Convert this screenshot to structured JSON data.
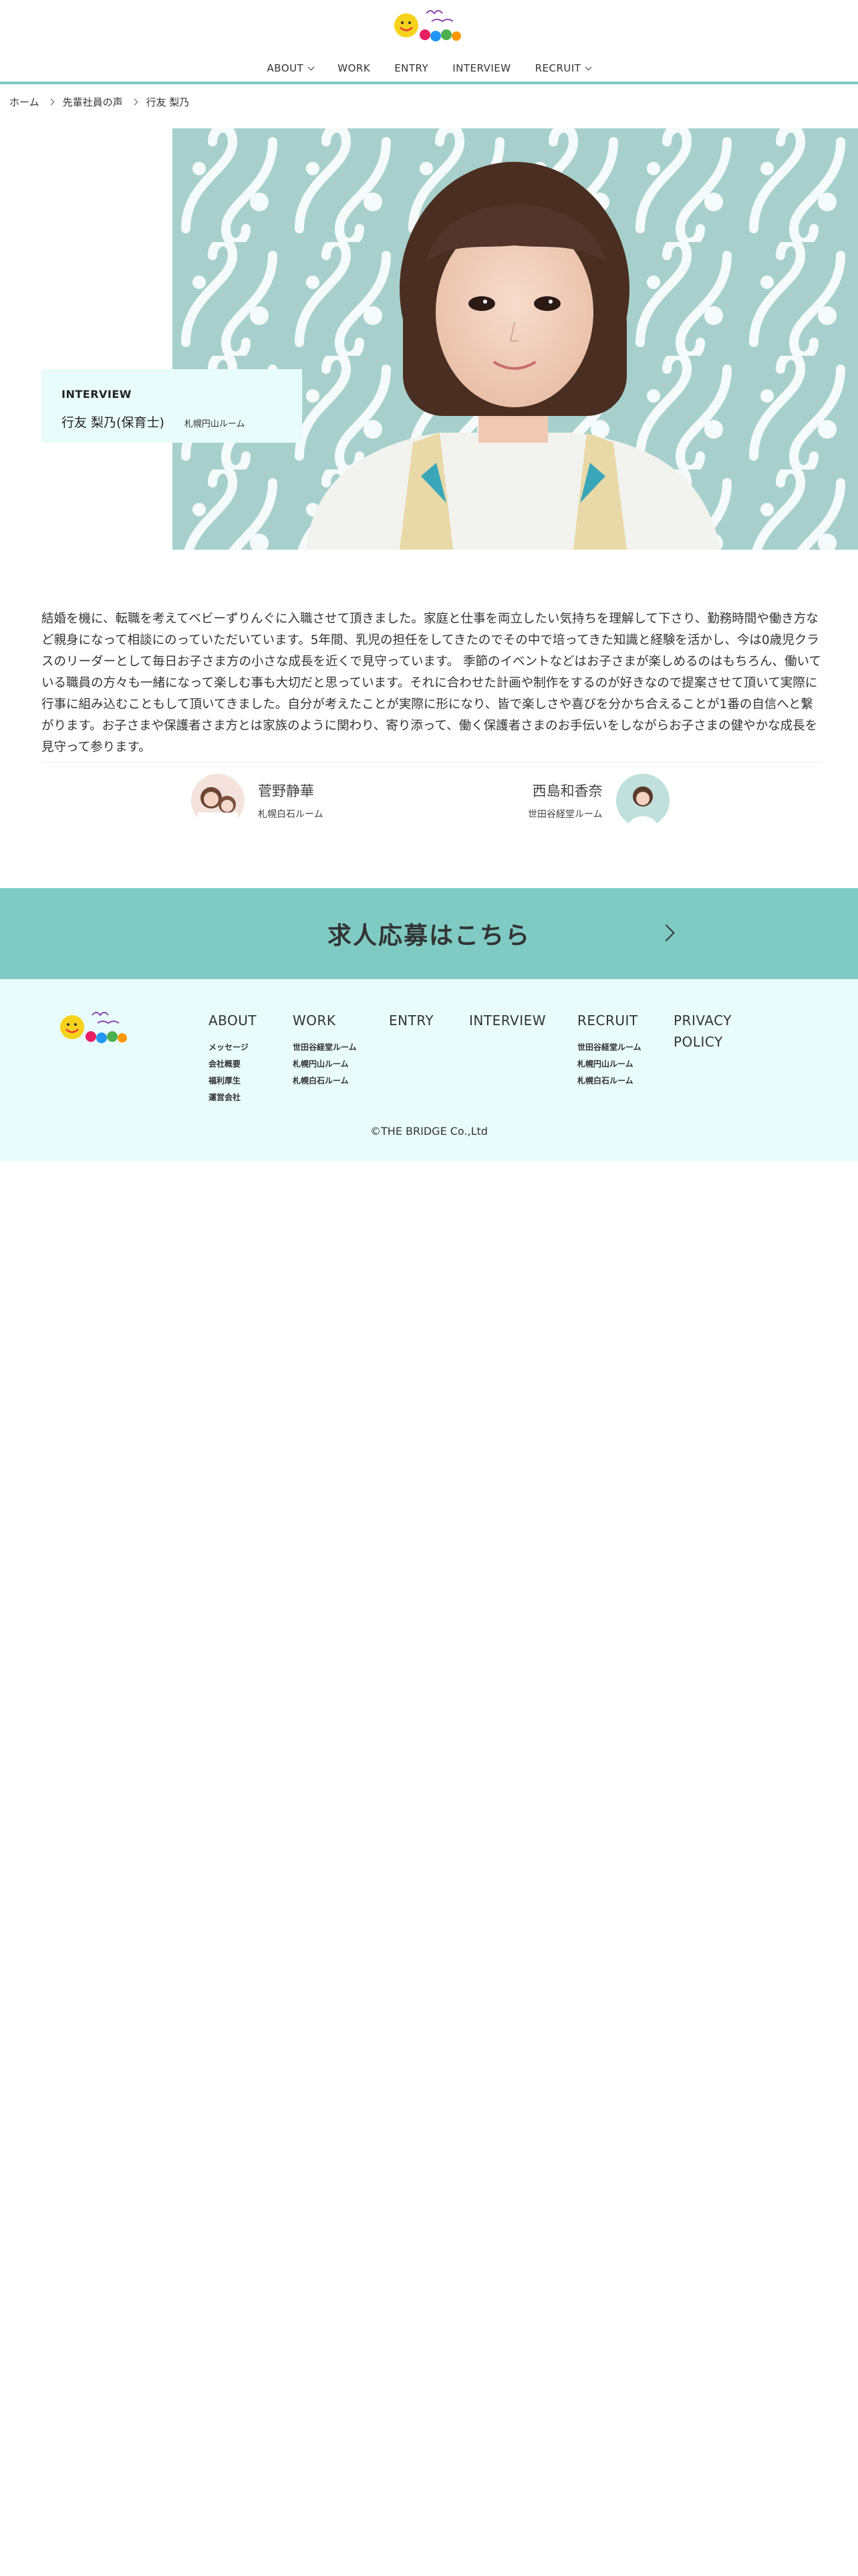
{
  "header": {
    "nav": [
      {
        "label": "ABOUT",
        "has_dropdown": true
      },
      {
        "label": "WORK",
        "has_dropdown": false
      },
      {
        "label": "ENTRY",
        "has_dropdown": false
      },
      {
        "label": "INTERVIEW",
        "has_dropdown": false
      },
      {
        "label": "RECRUIT",
        "has_dropdown": true
      }
    ]
  },
  "breadcrumb": [
    "ホーム",
    "先輩社員の声",
    "行友 梨乃"
  ],
  "card": {
    "label": "INTERVIEW",
    "name": "行友 梨乃(保育士)",
    "room": "札幌円山ルーム"
  },
  "body_text": "結婚を機に、転職を考えてベビーずりんぐに入職させて頂きました。家庭と仕事を両立したい気持ちを理解して下さり、勤務時間や働き方など親身になって相談にのっていただいています。5年間、乳児の担任をしてきたのでその中で培ってきた知識と経験を活かし、今は0歳児クラスのリーダーとして毎日お子さま方の小さな成長を近くで見守っています。 季節のイベントなどはお子さまが楽しめるのはもちろん、働いている職員の方々も一緒になって楽しむ事も大切だと思っています。それに合わせた計画や制作をするのが好きなので提案させて頂いて実際に行事に組み込むこともして頂いてきました。自分が考えたことが実際に形になり、皆で楽しさや喜びを分かち合えることが1番の自信へと繋がります。お子さまや保護者さま方とは家族のように関わり、寄り添って、働く保護者さまのお手伝いをしながらお子さまの健やかな成長を見守って参ります。",
  "others": [
    {
      "name": "菅野静華",
      "room": "札幌白石ルーム"
    },
    {
      "name": "西島和香奈",
      "room": "世田谷経堂ルーム"
    }
  ],
  "cta": {
    "label": "求人応募はこちら"
  },
  "footer": {
    "columns": [
      {
        "head": "ABOUT",
        "links": [
          "メッセージ",
          "会社概要",
          "福利厚生",
          "運営会社"
        ]
      },
      {
        "head": "WORK",
        "links": [
          "世田谷経堂ルーム",
          "札幌円山ルーム",
          "札幌白石ルーム"
        ]
      },
      {
        "head": "ENTRY",
        "links": []
      },
      {
        "head": "INTERVIEW",
        "links": []
      },
      {
        "head": "RECRUIT",
        "links": [
          "世田谷経堂ルーム",
          "札幌円山ルーム",
          "札幌白石ルーム"
        ]
      },
      {
        "head": "PRIVACY POLICY",
        "links": []
      }
    ],
    "copyright": "©THE BRIDGE Co.,Ltd"
  },
  "colors": {
    "accent": "#7fcbc3",
    "footer_bg": "#e9fcfc",
    "card_bg": "#e9fcfc"
  }
}
